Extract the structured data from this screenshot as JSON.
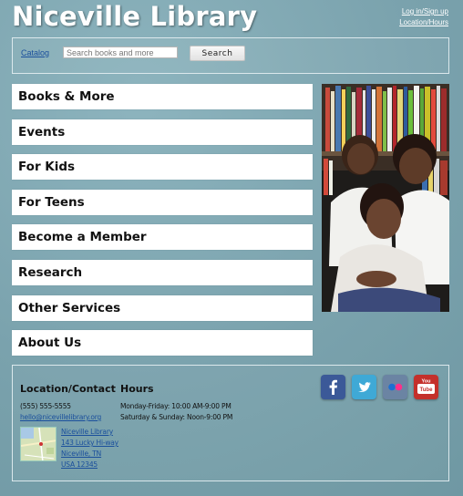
{
  "header": {
    "site_title": "Niceville Library",
    "login_link": "Log in/Sign up",
    "location_link": "Location/Hours"
  },
  "search": {
    "catalog_link": "Catalog",
    "placeholder": "Search books and more",
    "button_label": "Search"
  },
  "nav": {
    "items": [
      {
        "label": "Books & More"
      },
      {
        "label": "Events"
      },
      {
        "label": "For Kids"
      },
      {
        "label": "For Teens"
      },
      {
        "label": "Become a Member"
      },
      {
        "label": "Research"
      },
      {
        "label": "Other Services"
      },
      {
        "label": "About Us"
      }
    ]
  },
  "footer": {
    "location_heading": "Location/Contact",
    "phone": "(555) 555-5555",
    "email": "hello@nicevillelibrary.org",
    "address": {
      "line1": "Niceville Library",
      "line2": "143 Lucky Hi-way",
      "line3": "Niceville, TN",
      "line4": "USA 12345"
    },
    "hours_heading": "Hours",
    "hours_weekday": "Monday-Friday: 10:00 AM-9:00 PM",
    "hours_weekend": "Saturday & Sunday: Noon-9:00 PM",
    "social": [
      {
        "icon": "facebook-icon",
        "color": "#3b5998"
      },
      {
        "icon": "twitter-icon",
        "color": "#3fa9d6"
      },
      {
        "icon": "flickr-icon",
        "color": "#6b84a3"
      },
      {
        "icon": "youtube-icon",
        "color": "#c4302b"
      }
    ]
  }
}
